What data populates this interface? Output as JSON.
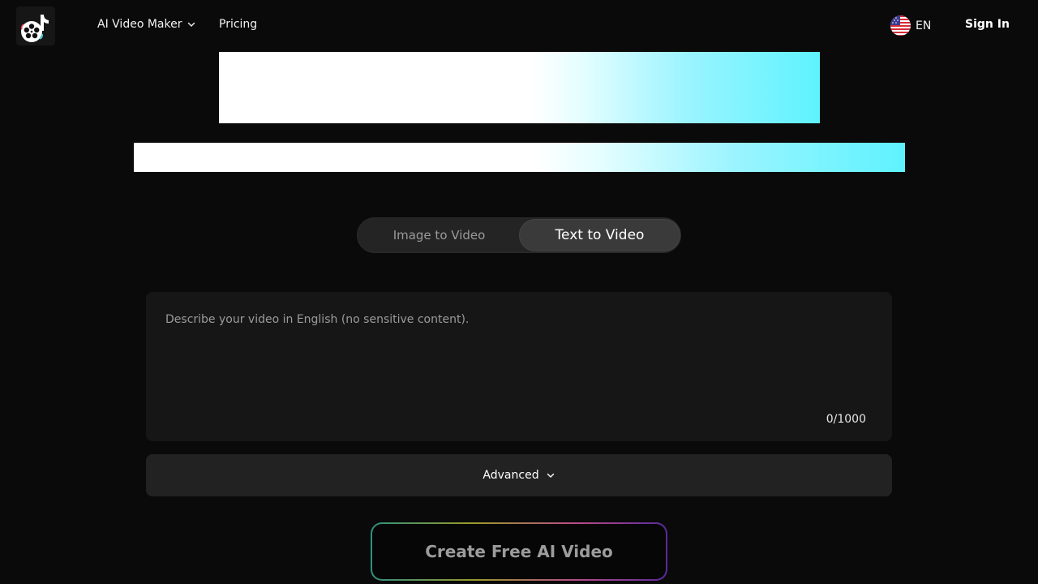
{
  "header": {
    "nav": {
      "video_maker_label": "AI Video Maker",
      "pricing_label": "Pricing"
    },
    "language": {
      "code": "EN",
      "flag_icon": "us-flag-icon"
    },
    "sign_in_label": "Sign In"
  },
  "tabs": [
    {
      "label": "Image to Video",
      "active": false
    },
    {
      "label": "Text to Video",
      "active": true
    }
  ],
  "prompt": {
    "placeholder": "Describe your video in English (no sensitive content).",
    "value": "",
    "counter": "0/1000"
  },
  "advanced": {
    "label": "Advanced",
    "icon": "chevron-down-icon"
  },
  "create_button_label": "Create Free AI Video",
  "colors": {
    "background": "#0a0a0a",
    "banner_accent": "#5ef3ff",
    "panel": "#161616",
    "active_tab": "#3a3a3a"
  }
}
